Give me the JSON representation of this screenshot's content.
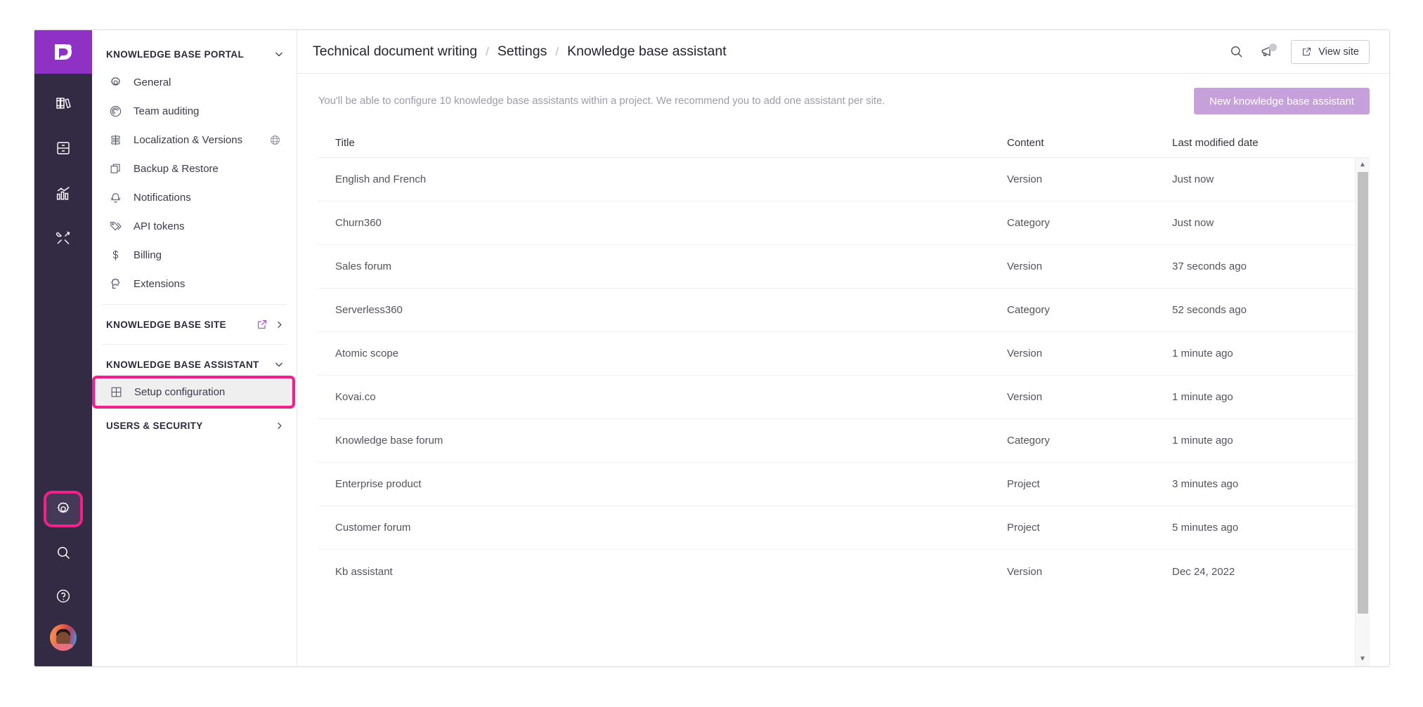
{
  "app": {
    "logo_alt": "document360-logo"
  },
  "rail": {
    "top_items": [
      {
        "name": "documentation",
        "icon": "books-icon"
      },
      {
        "name": "drive",
        "icon": "file-cabinet-icon"
      },
      {
        "name": "analytics",
        "icon": "analytics-chart-icon"
      },
      {
        "name": "tools",
        "icon": "tools-icon"
      }
    ],
    "bottom_items": [
      {
        "name": "settings",
        "icon": "gear-icon",
        "highlighted": true
      },
      {
        "name": "search",
        "icon": "search-icon",
        "highlighted": false
      },
      {
        "name": "help",
        "icon": "question-circle-icon",
        "highlighted": false
      }
    ],
    "avatar": "user-avatar"
  },
  "breadcrumb": {
    "project": "Technical document writing",
    "section": "Settings",
    "page": "Knowledge base assistant",
    "separator": "/"
  },
  "topbar": {
    "search_icon": "search-icon",
    "announcement_icon": "megaphone-icon",
    "view_site_label": "View site",
    "external_link_icon": "external-link-icon"
  },
  "sidebar": {
    "groups": [
      {
        "label": "KNOWLEDGE BASE PORTAL",
        "chevron": "chevron-down",
        "items": [
          {
            "label": "General",
            "icon": "gear-icon"
          },
          {
            "label": "Team auditing",
            "icon": "audit-target-icon"
          },
          {
            "label": "Localization & Versions",
            "icon": "localization-icon",
            "trailing_icon": "globe-icon"
          },
          {
            "label": "Backup & Restore",
            "icon": "copy-stack-icon"
          },
          {
            "label": "Notifications",
            "icon": "bell-icon"
          },
          {
            "label": "API tokens",
            "icon": "tag-icon"
          },
          {
            "label": "Billing",
            "icon": "dollar-icon"
          },
          {
            "label": "Extensions",
            "icon": "puzzle-icon"
          }
        ]
      },
      {
        "label": "KNOWLEDGE BASE SITE",
        "chevron": "chevron-right",
        "trailing_icon": "external-link-icon",
        "items": []
      },
      {
        "label": "KNOWLEDGE BASE ASSISTANT",
        "chevron": "chevron-down",
        "items": [
          {
            "label": "Setup configuration",
            "icon": "grid-table-icon",
            "selected": true,
            "highlighted": true
          }
        ]
      },
      {
        "label": "USERS & SECURITY",
        "chevron": "chevron-right",
        "items": []
      }
    ]
  },
  "main": {
    "notice": "You'll be able to configure 10 knowledge base assistants within a project. We recommend you to add one assistant per site.",
    "new_button_label": "New knowledge base assistant",
    "table": {
      "columns": [
        "Title",
        "Content",
        "Last modified date"
      ],
      "rows": [
        {
          "title": "English and French",
          "content": "Version",
          "modified": "Just now"
        },
        {
          "title": "Churn360",
          "content": "Category",
          "modified": "Just now"
        },
        {
          "title": "Sales forum",
          "content": "Version",
          "modified": "37 seconds ago"
        },
        {
          "title": "Serverless360",
          "content": "Category",
          "modified": "52 seconds ago"
        },
        {
          "title": "Atomic scope",
          "content": "Version",
          "modified": "1 minute ago"
        },
        {
          "title": "Kovai.co",
          "content": "Version",
          "modified": "1 minute ago"
        },
        {
          "title": "Knowledge base forum",
          "content": "Category",
          "modified": "1 minute ago"
        },
        {
          "title": "Enterprise product",
          "content": "Project",
          "modified": "3 minutes ago"
        },
        {
          "title": "Customer forum",
          "content": "Project",
          "modified": "5 minutes ago"
        },
        {
          "title": "Kb assistant",
          "content": "Version",
          "modified": "Dec 24, 2022"
        }
      ]
    },
    "scrollbar": {
      "up_arrow": "▲",
      "down_arrow": "▼"
    }
  },
  "colors": {
    "brand_purple": "#8e31c4",
    "rail_dark": "#332b43",
    "highlight_pink": "#f2208a",
    "button_lavender": "#c6a0da"
  }
}
